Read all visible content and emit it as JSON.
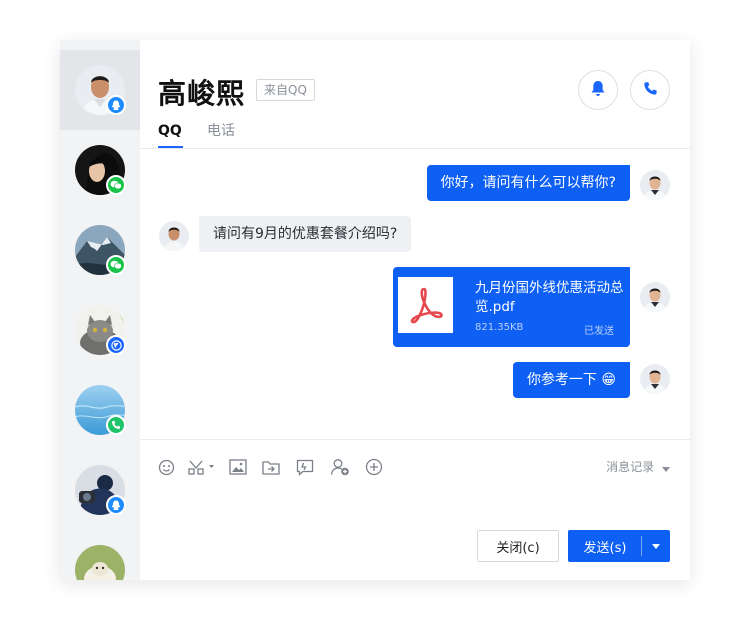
{
  "contacts": [
    {
      "name": "contact-1",
      "channel": "qq",
      "active": true
    },
    {
      "name": "contact-2",
      "channel": "wechat",
      "active": false
    },
    {
      "name": "contact-3",
      "channel": "wechat",
      "active": false
    },
    {
      "name": "contact-4",
      "channel": "web",
      "active": false
    },
    {
      "name": "contact-5",
      "channel": "phone",
      "active": false
    },
    {
      "name": "contact-6",
      "channel": "qq",
      "active": false
    },
    {
      "name": "contact-7",
      "channel": "unknown",
      "active": false
    }
  ],
  "header": {
    "title": "高峻熙",
    "source_tag": "来自QQ",
    "bell_icon": "bell-icon",
    "phone_icon": "phone-icon"
  },
  "tabs": [
    {
      "label": "QQ",
      "active": true
    },
    {
      "label": "电话",
      "active": false
    }
  ],
  "messages": [
    {
      "direction": "out",
      "text": "你好，请问有什么可以帮你?"
    },
    {
      "direction": "in",
      "text": "请问有9月的优惠套餐介绍吗?"
    },
    {
      "direction": "out",
      "type": "file",
      "file_name": "九月份国外线优惠活动总览.pdf",
      "file_size": "821.35KB",
      "status": "已发送",
      "icon": "pdf-icon"
    },
    {
      "direction": "out",
      "text": "你参考一下",
      "emoji": "😁"
    }
  ],
  "toolbar": {
    "icons": [
      "emoji-icon",
      "scissors-icon",
      "image-icon",
      "folder-transfer-icon",
      "feedback-icon",
      "add-contact-icon",
      "plus-circle-icon"
    ],
    "history_label": "消息记录"
  },
  "actions": {
    "close_label": "关闭(c)",
    "send_label": "发送(s)"
  },
  "colors": {
    "accent": "#0e5ff3",
    "qq_badge": "#1e8bff",
    "wechat_badge": "#19c34a",
    "phone_badge": "#1fc46a"
  }
}
